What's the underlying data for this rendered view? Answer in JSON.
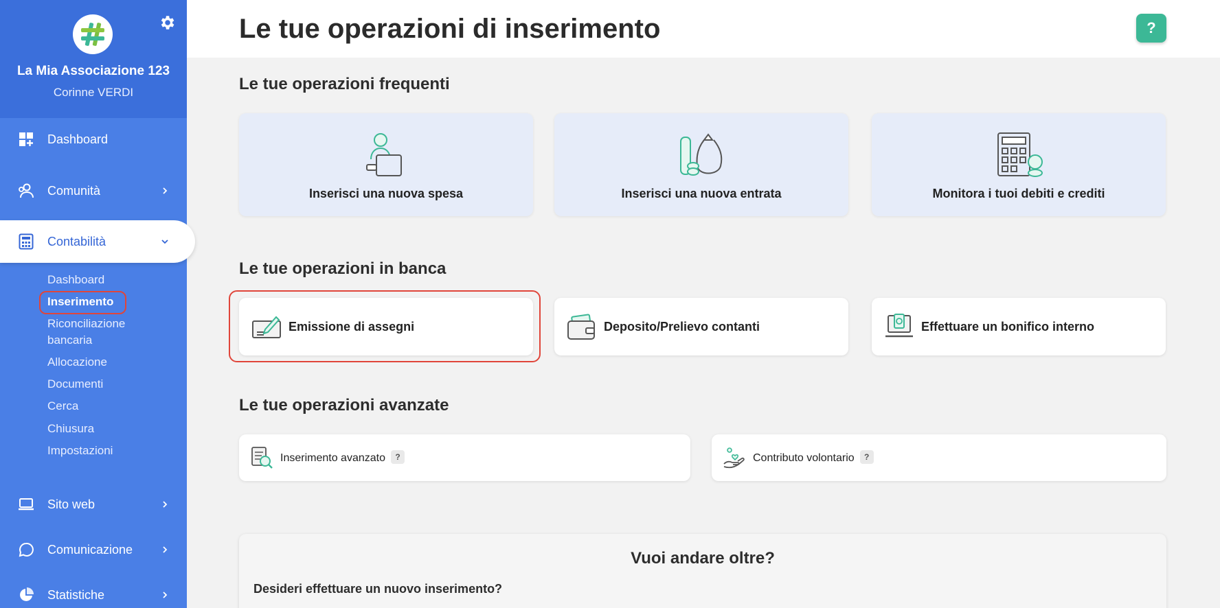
{
  "sidebar": {
    "org_name": "La Mia Associazione 123",
    "user_name": "Corinne VERDI",
    "nav": {
      "dashboard": "Dashboard",
      "comunita": "Comunità",
      "contabilita": "Contabilità",
      "sito_web": "Sito web",
      "comunicazione": "Comunicazione",
      "statistiche": "Statistiche"
    },
    "sub_items": [
      "Dashboard",
      "Inserimento",
      "Riconciliazione",
      "bancaria",
      "Allocazione",
      "Documenti",
      "Cerca",
      "Chiusura",
      "Impostazioni"
    ]
  },
  "header": {
    "title": "Le tue operazioni di inserimento",
    "help_label": "?"
  },
  "frequent": {
    "title": "Le tue operazioni frequenti",
    "cards": [
      "Inserisci una nuova spesa",
      "Inserisci una nuova entrata",
      "Monitora i tuoi debiti e crediti"
    ]
  },
  "bank": {
    "title": "Le tue operazioni in banca",
    "cards": [
      "Emissione di assegni",
      "Deposito/Prelievo contanti",
      "Effettuare un bonifico interno"
    ]
  },
  "advanced": {
    "title": "Le tue operazioni avanzate",
    "cards": [
      "Inserimento avanzato",
      "Contributo volontario"
    ],
    "badge": "?"
  },
  "more": {
    "title": "Vuoi andare oltre?",
    "subtitle": "Desideri effettuare un nuovo inserimento?"
  },
  "colors": {
    "sidebar": "#4a7fe6",
    "sidebar_header": "#3b6fdb",
    "accent_green": "#3cb896",
    "highlight_red": "#e0453a",
    "card_light_blue": "#e6ecf9"
  },
  "icons": [
    "gear-icon",
    "logo-hash-icon",
    "dashboard-icon",
    "users-icon",
    "calculator-icon",
    "laptop-icon",
    "chat-icon",
    "pie-chart-icon",
    "chevron-right-icon",
    "chevron-down-icon",
    "expense-illustration",
    "income-illustration",
    "debts-illustration",
    "check-icon",
    "wallet-icon",
    "transfer-icon",
    "advanced-search-icon",
    "donation-icon"
  ]
}
